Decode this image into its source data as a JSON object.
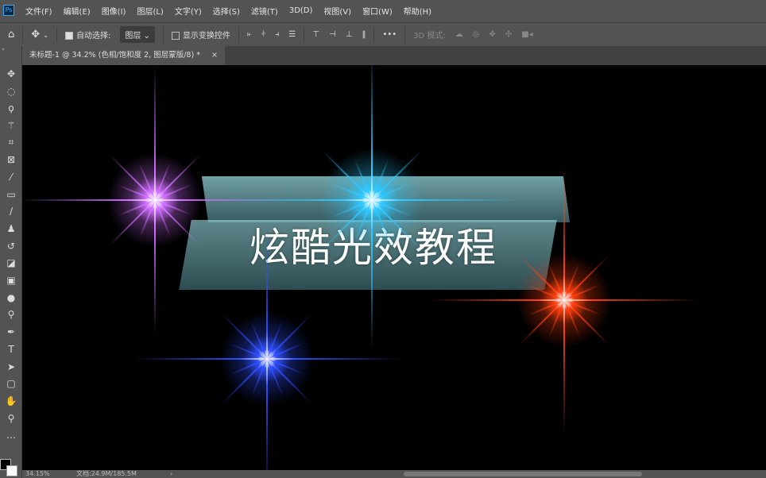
{
  "app": {
    "logo": "Ps"
  },
  "menu": [
    "文件(F)",
    "编辑(E)",
    "图像(I)",
    "图层(L)",
    "文字(Y)",
    "选择(S)",
    "滤镜(T)",
    "3D(D)",
    "视图(V)",
    "窗口(W)",
    "帮助(H)"
  ],
  "options": {
    "auto_select_label": "自动选择:",
    "auto_select_checked": true,
    "target_value": "图层",
    "show_transform_label": "显示变换控件",
    "show_transform_checked": false,
    "more": "•••",
    "mode_3d_label": "3D 模式:"
  },
  "document_tab": {
    "title": "未标题-1 @ 34.2% (色相/饱和度 2, 图层蒙版/8) *",
    "close": "×"
  },
  "tools": [
    "move-icon",
    "marquee-icon",
    "lasso-icon",
    "magic-wand-icon",
    "crop-icon",
    "frame-icon",
    "eyedropper-icon",
    "healing-icon",
    "brush-icon",
    "stamp-icon",
    "history-brush-icon",
    "eraser-icon",
    "gradient-icon",
    "blur-icon",
    "dodge-icon",
    "pen-icon",
    "type-icon",
    "path-select-icon",
    "shape-icon",
    "hand-icon",
    "zoom-icon",
    "more-icon"
  ],
  "canvas": {
    "title_text": "炫酷光效教程",
    "stars": [
      {
        "name": "purple",
        "color": "#d070ff"
      },
      {
        "name": "cyan",
        "color": "#30c8ff"
      },
      {
        "name": "red",
        "color": "#ff4010"
      },
      {
        "name": "blue",
        "color": "#3050ff"
      }
    ]
  },
  "status": {
    "zoom": "34.15%",
    "doc_size": "文档:24.9M/185.5M"
  }
}
